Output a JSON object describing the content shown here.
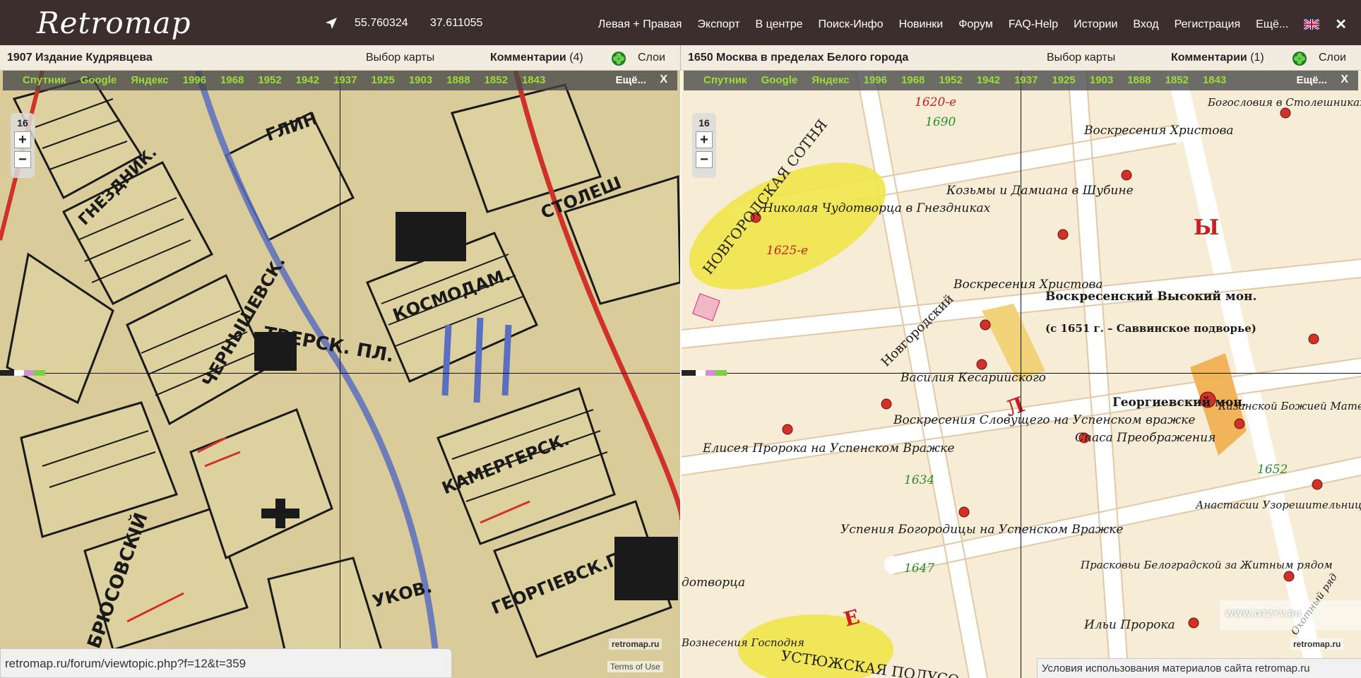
{
  "header": {
    "logo": "Retromap",
    "lat": "55.760324",
    "lon": "37.611055",
    "menu": [
      "Левая + Правая",
      "Экспорт",
      "В центре",
      "Поиск-Инфо",
      "Новинки",
      "Форум",
      "FAQ-Help",
      "Истории",
      "Вход",
      "Регистрация",
      "Ещё..."
    ],
    "close": "✕"
  },
  "left_pane": {
    "title": "1907 Издание Кудрявцева",
    "map_select": "Выбор карты",
    "comments_label": "Комментарии",
    "comments_count": "(4)",
    "layers": "Слои",
    "years": [
      "Спутник",
      "Google",
      "Яндекс",
      "1996",
      "1968",
      "1952",
      "1942",
      "1937",
      "1925",
      "1903",
      "1888",
      "1852",
      "1843"
    ],
    "more": "Ещё...",
    "close": "X",
    "zoom_level": "16",
    "zoom_in": "+",
    "zoom_out": "−",
    "watermark": "retromap.ru",
    "terms": "Terms of Use",
    "map_labels": [
      "ТВЕРСК. ПЛ.",
      "КОСМОДАМ.",
      "КАМЕРГЕРСК.",
      "ГЕОРГIЕВСК.П.",
      "БРЮСОВСКIЙ",
      "СТОЛЕШ",
      "ГЛИН",
      "ЧЕРНЫШЕВСК.",
      "ГНЕЗДНИК.",
      "УКОВ."
    ]
  },
  "right_pane": {
    "title": "1650 Москва в пределах Белого города",
    "map_select": "Выбор карты",
    "comments_label": "Комментарии",
    "comments_count": "(1)",
    "layers": "Слои",
    "years": [
      "Спутник",
      "Google",
      "Яндекс",
      "1996",
      "1968",
      "1952",
      "1942",
      "1937",
      "1925",
      "1903",
      "1888",
      "1852",
      "1843"
    ],
    "more": "Ещё...",
    "close": "X",
    "zoom_level": "16",
    "zoom_in": "+",
    "zoom_out": "−",
    "watermark": "retromap.ru",
    "map_labels": {
      "novgorod": "НОВГОРОДСКАЯ СОТНЯ",
      "nikolay": "Николая Чудотворца в Гнездниках",
      "y1625": "1625-е",
      "y1620": "1620-е",
      "y1690": "1690",
      "kozma": "Козьмы и Дамиана в Шубине",
      "voskr_hr": "Воскресения Христова",
      "voskr_hr2": "Воскресения Христова",
      "novgorodsky": "Новгородский",
      "voskr_mon": "Воскресенский Высокий мон.",
      "savv": "(с 1651 г. – Саввинское подворье)",
      "vasily": "Василия Кесарийского",
      "voskr_slov": "Воскресения Словущего на Успенском вражке",
      "y1634": "1634",
      "elisey": "Елисея Пророка на Успенском Вражке",
      "uspen": "Успения Богородицы на Успенском Вражке",
      "y1647": "1647",
      "georg_mon": "Георгиевский мон.",
      "spas": "Спаса Преображения",
      "kazan": "Казанской Божией Матери",
      "y1652": "1652",
      "anast": "Анастасии Узорешительницы",
      "praskov": "Прасковьи Белоградской за Житным рядом",
      "ilya": "Ильи Пророка",
      "ustyug": "УСТЮЖСКАЯ ПОЛУСО",
      "bogosl": "Богословия в Столешниках",
      "gdotv": "дотворца",
      "vozn": "Вознесения Господня",
      "okhot": "Охотный ряд",
      "letter_y": "Ы",
      "letter_l": "Л",
      "letter_e": "Е"
    }
  },
  "status_url": "retromap.ru/forum/viewtopic.php?f=12&t=359",
  "usage": "Условия использования материалов сайта retromap.ru",
  "otzyv": "WWW.OTZYV.RU"
}
